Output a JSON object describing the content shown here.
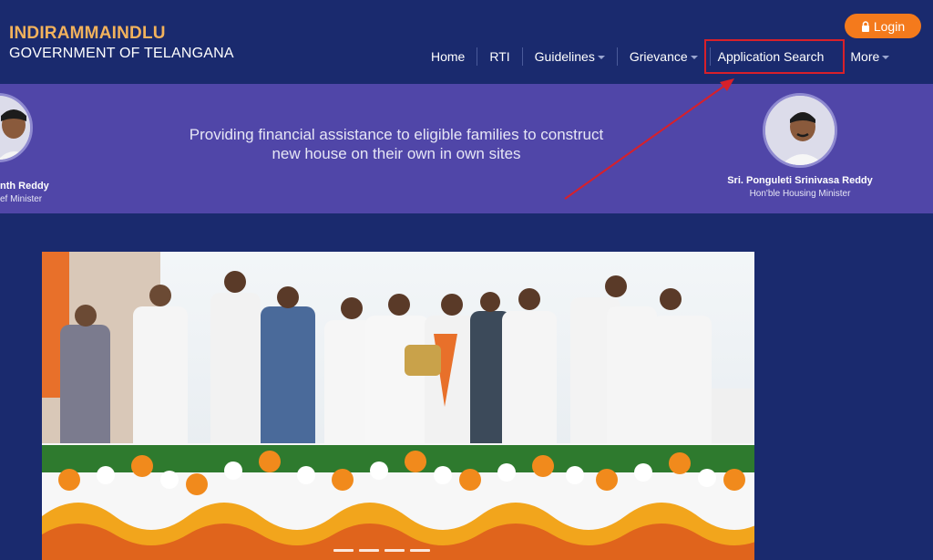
{
  "header": {
    "brand_line1": "INDIRAMMAINDLU",
    "brand_line2": "GOVERNMENT OF TELANGANA",
    "login_label": "Login",
    "login_icon": "lock-icon"
  },
  "nav": {
    "items": [
      {
        "label": "Home",
        "has_dropdown": false
      },
      {
        "label": "RTI",
        "has_dropdown": false
      },
      {
        "label": "Guidelines",
        "has_dropdown": true
      },
      {
        "label": "Grievance",
        "has_dropdown": true
      },
      {
        "label": "Application Search",
        "has_dropdown": false,
        "highlighted": true
      },
      {
        "label": "More",
        "has_dropdown": true
      }
    ]
  },
  "banner": {
    "tagline_line1": "Providing financial assistance to eligible families to construct",
    "tagline_line2": "new house on their own in own sites",
    "left_person": {
      "name": "nth Reddy",
      "title": "ef Minister"
    },
    "right_person": {
      "name": "Sri. Ponguleti Srinivasa Reddy",
      "title": "Hon'ble Housing Minister"
    }
  },
  "colors": {
    "header_bg": "#1a2a6e",
    "banner_bg": "#5046a8",
    "brand_accent": "#f2b25c",
    "login_bg": "#f47a1c",
    "highlight": "#d8202a"
  }
}
